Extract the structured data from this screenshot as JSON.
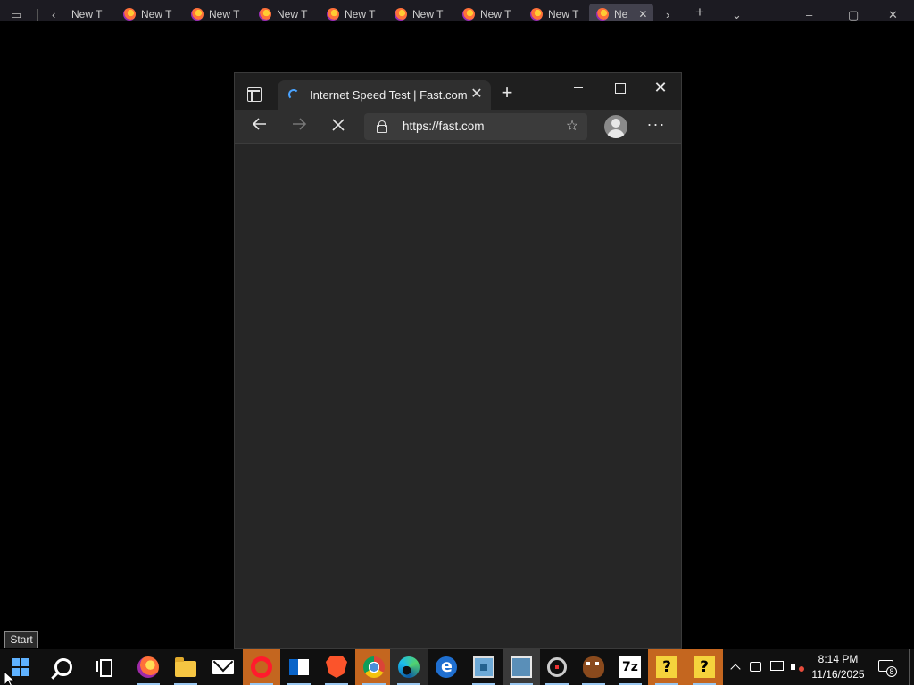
{
  "background_window": {
    "tabs": [
      "New T",
      "New T",
      "New T",
      "New T",
      "New T",
      "New T",
      "New T"
    ],
    "active_tab": "Ne"
  },
  "edge": {
    "tab_title": "Internet Speed Test | Fast.com",
    "url": "https://fast.com",
    "window_buttons": {
      "minimize": "minimize",
      "maximize": "maximize",
      "close": "✕"
    }
  },
  "tooltip": {
    "text": "Start"
  },
  "taskbar": {
    "clock_time": "8:14 PM",
    "clock_date": "11/16/2025",
    "notification_count": "8",
    "apps": [
      {
        "name": "start",
        "icon": "windows-logo-icon"
      },
      {
        "name": "search",
        "icon": "search-icon"
      },
      {
        "name": "task-view",
        "icon": "task-view-icon"
      },
      {
        "name": "firefox",
        "icon": "firefox-icon"
      },
      {
        "name": "file-explorer",
        "icon": "folder-icon"
      },
      {
        "name": "mail",
        "icon": "mail-icon"
      },
      {
        "name": "opera",
        "icon": "opera-icon"
      },
      {
        "name": "outlook",
        "icon": "outlook-icon"
      },
      {
        "name": "brave",
        "icon": "brave-icon"
      },
      {
        "name": "chrome",
        "icon": "chrome-icon"
      },
      {
        "name": "edge",
        "icon": "edge-icon"
      },
      {
        "name": "internet-explorer",
        "icon": "ie-icon"
      },
      {
        "name": "network-app",
        "icon": "network-app-icon"
      },
      {
        "name": "network-app-2",
        "icon": "network-app-icon"
      },
      {
        "name": "tool",
        "icon": "tool-icon"
      },
      {
        "name": "game",
        "icon": "freddy-icon"
      },
      {
        "name": "7zip",
        "icon": "7zip-icon",
        "label": "7z"
      },
      {
        "name": "help-1",
        "icon": "help-icon",
        "label": "?"
      },
      {
        "name": "help-2",
        "icon": "help-icon",
        "label": "?"
      }
    ]
  },
  "colors": {
    "desktop": "#000000",
    "edge_frame": "#1f1f1f",
    "edge_toolbar": "#2f2f2f",
    "edge_content": "#262626",
    "taskbar": "#101010",
    "highlight": "#c4661f",
    "accent": "#5fb2ff"
  }
}
